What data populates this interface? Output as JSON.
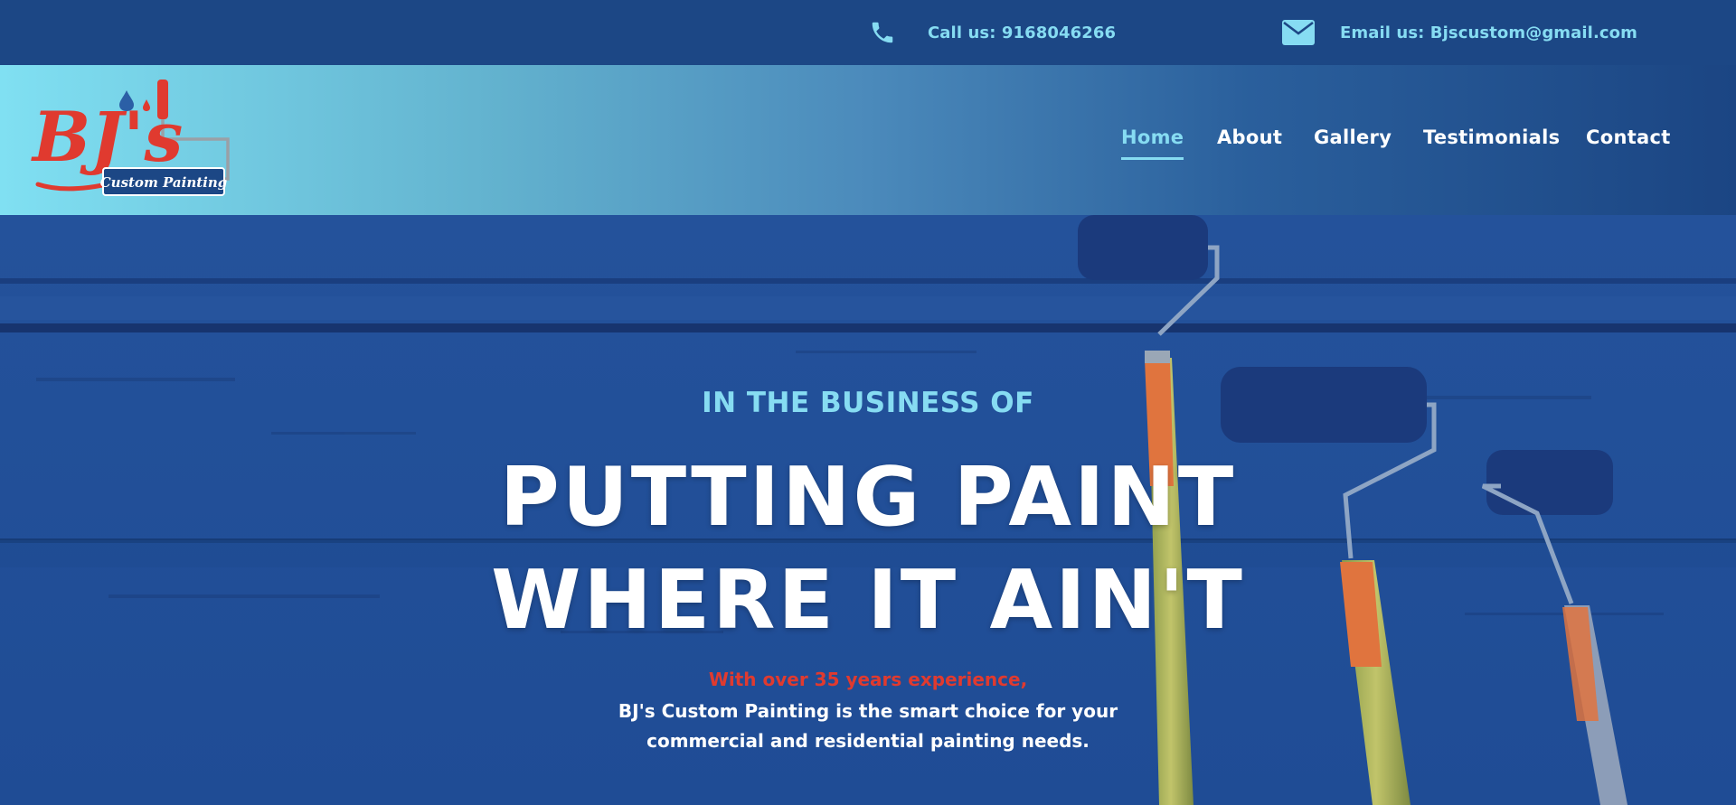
{
  "topbar": {
    "phone": {
      "icon": "phone-icon",
      "text": "Call us: 9168046266"
    },
    "email": {
      "icon": "envelope-icon",
      "text": "Email us: Bjscustom@gmail.com"
    }
  },
  "header": {
    "logo": {
      "main": "BJ's",
      "sub": "Custom Painting"
    },
    "nav": [
      {
        "label": "Home",
        "active": true
      },
      {
        "label": "About",
        "active": false
      },
      {
        "label": "Gallery",
        "active": false
      },
      {
        "label": "Testimonials",
        "active": false
      },
      {
        "label": "Contact",
        "active": false
      }
    ]
  },
  "hero": {
    "eyebrow": "IN THE BUSINESS OF",
    "headline_line1": "PUTTING PAINT",
    "headline_line2": "WHERE IT AIN'T",
    "highlight": "With over 35 years experience,",
    "desc_line1": "BJ's Custom Painting is the smart choice for your",
    "desc_line2": "commercial and residential painting needs."
  },
  "colors": {
    "topbar": "#1c4785",
    "accent": "#86dcf2",
    "highlight_red": "#e03a2f",
    "hero_blue": "#21509a"
  }
}
